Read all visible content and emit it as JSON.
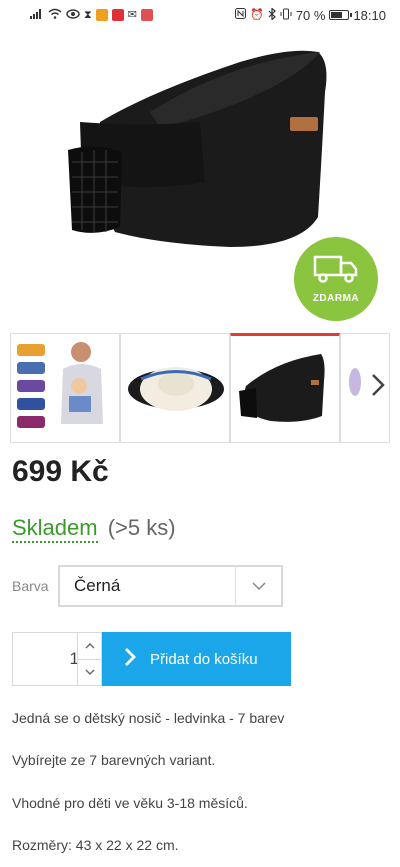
{
  "status_bar": {
    "battery_percent": "70 %",
    "time": "18:10"
  },
  "hero": {
    "badge_label": "ZDARMA",
    "badge_color": "#8bc53f",
    "badge_icon": "delivery-truck-icon"
  },
  "thumbnails": {
    "items": [
      "color-variants-thumbnail",
      "carrier-top-view-thumbnail",
      "carrier-black-side-thumbnail",
      "carrier-partial-thumbnail"
    ],
    "active_index": 2,
    "active_color": "#e53935",
    "next_icon": "chevron-right-icon"
  },
  "product": {
    "price": "699 Kč",
    "stock_label": "Skladem",
    "stock_count": "(>5 ks)",
    "stock_color": "#3a9a2a"
  },
  "options": {
    "color_label": "Barva",
    "color_selected": "Černá"
  },
  "cart": {
    "quantity": "1",
    "add_label": "Přidat do košíku",
    "add_color": "#1aa6e8"
  },
  "description": [
    "Jedná se o dětský nosič - ledvinka - 7 barev",
    "Vybírejte ze 7 barevných variant.",
    "Vhodné pro děti ve věku 3-18 měsíců.",
    "Rozměry: 43 x 22 x 22 cm."
  ]
}
